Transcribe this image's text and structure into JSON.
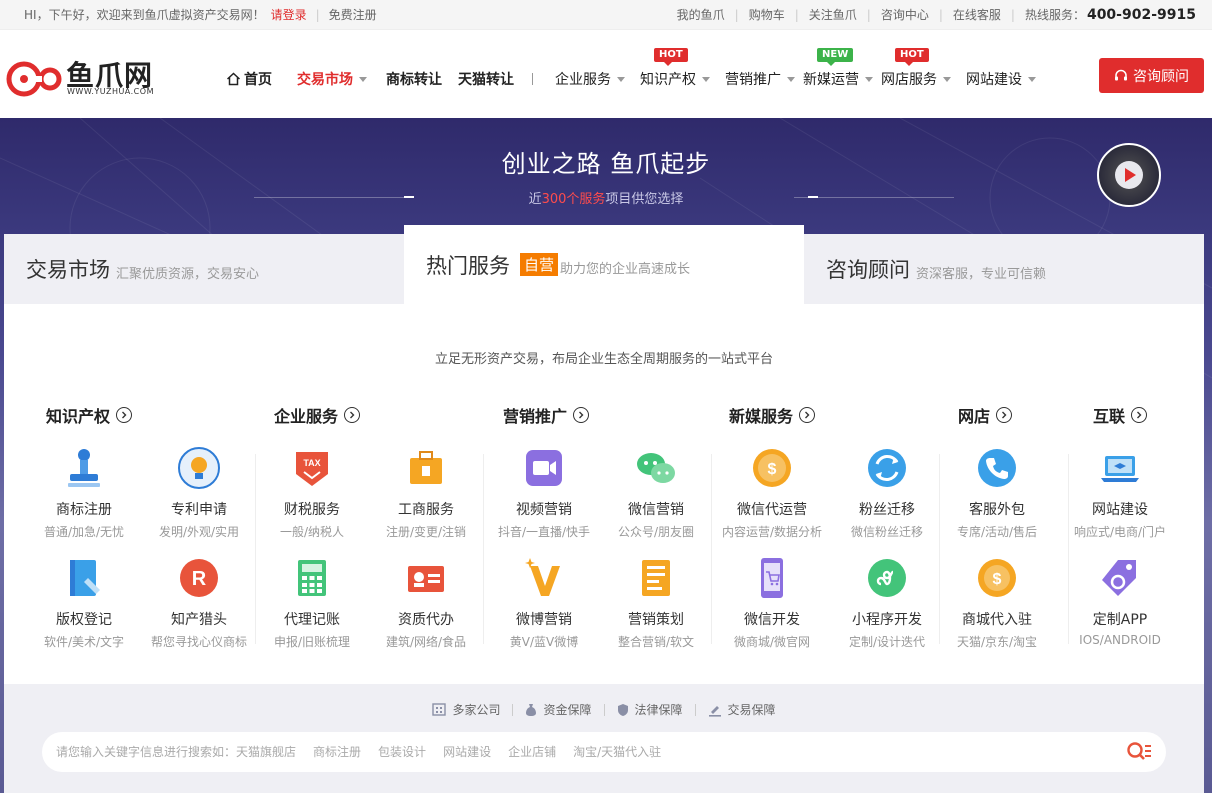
{
  "topbar": {
    "greeting": "HI，下午好，欢迎来到鱼爪虚拟资产交易网！",
    "login": "请登录",
    "register": "免费注册",
    "links": [
      "我的鱼爪",
      "购物车",
      "关注鱼爪",
      "咨询中心",
      "在线客服"
    ],
    "hotline_label": "热线服务：",
    "hotline_number": "400-902-9915"
  },
  "header": {
    "logo_text": "鱼爪网",
    "logo_sub": "WWW.YUZHUA.COM",
    "nav": [
      {
        "label": "首页"
      },
      {
        "label": "交易市场"
      },
      {
        "label": "商标转让"
      },
      {
        "label": "天猫转让"
      },
      {
        "label": "企业服务"
      },
      {
        "label": "知识产权",
        "badge": "HOT"
      },
      {
        "label": "营销推广"
      },
      {
        "label": "新媒运营",
        "badge": "NEW"
      },
      {
        "label": "网店服务",
        "badge": "HOT"
      },
      {
        "label": "网站建设"
      }
    ],
    "consult_button": "咨询顾问"
  },
  "banner": {
    "title": "创业之路 鱼爪起步",
    "sub_pre": "近",
    "sub_hl": "300个服务",
    "sub_post": "项目供您选择"
  },
  "tabs": [
    {
      "title": "交易市场",
      "sub": "汇聚优质资源，交易安心"
    },
    {
      "title": "热门服务",
      "tag": "自营",
      "sub": "助力您的企业高速成长"
    },
    {
      "title": "咨询顾问",
      "sub": "资深客服，专业可信赖"
    }
  ],
  "slogan": "立足无形资产交易，布局企业生态全周期服务的一站式平台",
  "categories": [
    "知识产权",
    "企业服务",
    "营销推广",
    "新媒服务",
    "网店",
    "互联"
  ],
  "services": [
    {
      "name": "商标注册",
      "desc": "普通/加急/无忧",
      "icon": "stamp-icon"
    },
    {
      "name": "专利申请",
      "desc": "发明/外观/实用",
      "icon": "bulb-icon"
    },
    {
      "name": "财税服务",
      "desc": "一般/纳税人",
      "icon": "tax-icon"
    },
    {
      "name": "工商服务",
      "desc": "注册/变更/注销",
      "icon": "briefcase-icon"
    },
    {
      "name": "视频营销",
      "desc": "抖音/一直播/快手",
      "icon": "video-icon"
    },
    {
      "name": "微信营销",
      "desc": "公众号/朋友圈",
      "icon": "wechat-icon"
    },
    {
      "name": "微信代运营",
      "desc": "内容运营/数据分析",
      "icon": "coin-icon"
    },
    {
      "name": "粉丝迁移",
      "desc": "微信粉丝迁移",
      "icon": "transfer-icon"
    },
    {
      "name": "客服外包",
      "desc": "专席/活动/售后",
      "icon": "phone-icon"
    },
    {
      "name": "网站建设",
      "desc": "响应式/电商/门户",
      "icon": "laptop-icon"
    },
    {
      "name": "版权登记",
      "desc": "软件/美术/文字",
      "icon": "book-icon"
    },
    {
      "name": "知产猎头",
      "desc": "帮您寻找心仪商标",
      "icon": "r-mark-icon"
    },
    {
      "name": "代理记账",
      "desc": "申报/旧账梳理",
      "icon": "calculator-icon"
    },
    {
      "name": "资质代办",
      "desc": "建筑/网络/食品",
      "icon": "id-card-icon"
    },
    {
      "name": "微博营销",
      "desc": "黄V/蓝V微博",
      "icon": "v-icon"
    },
    {
      "name": "营销策划",
      "desc": "整合营销/软文",
      "icon": "document-icon"
    },
    {
      "name": "微信开发",
      "desc": "微商城/微官网",
      "icon": "mobile-cart-icon"
    },
    {
      "name": "小程序开发",
      "desc": "定制/设计迭代",
      "icon": "miniprogram-icon"
    },
    {
      "name": "商城代入驻",
      "desc": "天猫/京东/淘宝",
      "icon": "shop-coin-icon"
    },
    {
      "name": "定制APP",
      "desc": "IOS/ANDROID",
      "icon": "app-tag-icon"
    }
  ],
  "guarantees": [
    "多家公司",
    "资金保障",
    "法律保障",
    "交易保障"
  ],
  "search": {
    "prefix": "请您输入关键字信息进行搜索如：",
    "examples": [
      "天猫旗舰店",
      "商标注册",
      "包装设计",
      "网站建设",
      "企业店铺",
      "淘宝/天猫代入驻"
    ]
  },
  "colors": {
    "brand_red": "#e02d2d",
    "orange": "#f57c00",
    "banner": "#3c3a7f"
  }
}
